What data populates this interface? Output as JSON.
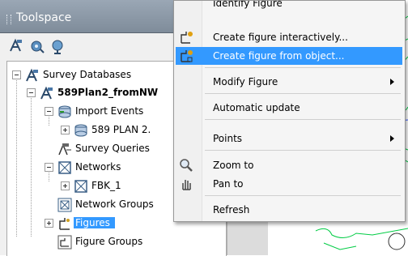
{
  "palette": {
    "title": "Toolspace",
    "toolbar_icons": [
      "survey-toolbar-icon",
      "settings-toolbar-icon",
      "equipment-toolbar-icon"
    ],
    "tree": [
      {
        "label": "Survey Databases",
        "icon": "survey-db-icon",
        "level": 0,
        "expander": "minus"
      },
      {
        "label": "589Plan2_fromNW",
        "icon": "database-icon",
        "level": 1,
        "expander": "minus",
        "bold": true
      },
      {
        "label": "Import Events",
        "icon": "import-events-icon",
        "level": 2,
        "expander": "minus"
      },
      {
        "label": "589 PLAN 2.",
        "icon": "import-event-icon",
        "level": 3,
        "expander": "plus"
      },
      {
        "label": "Survey Queries",
        "icon": "survey-queries-icon",
        "level": 2,
        "expander": null
      },
      {
        "label": "Networks",
        "icon": "networks-icon",
        "level": 2,
        "expander": "minus"
      },
      {
        "label": "FBK_1",
        "icon": "network-icon",
        "level": 3,
        "expander": "plus"
      },
      {
        "label": "Network Groups",
        "icon": "network-groups-icon",
        "level": 2,
        "expander": null
      },
      {
        "label": "Figures",
        "icon": "figures-icon",
        "level": 2,
        "expander": "plus",
        "selected": true
      },
      {
        "label": "Figure Groups",
        "icon": "figure-groups-icon",
        "level": 2,
        "expander": null
      }
    ]
  },
  "context_menu": {
    "items": [
      {
        "label": "Identify Figure",
        "icon": null,
        "highlight": false,
        "submenu": false,
        "partial": true
      },
      {
        "label": "Create figure interactively...",
        "icon": "create-figure-icon",
        "highlight": false,
        "submenu": false
      },
      {
        "label": "Create figure from object...",
        "icon": "create-figure-object-icon",
        "highlight": true,
        "submenu": false
      },
      {
        "label": "Modify Figure",
        "icon": null,
        "highlight": false,
        "submenu": true
      },
      {
        "label": "Automatic update",
        "icon": null,
        "highlight": false,
        "submenu": false
      },
      {
        "label": "Points",
        "icon": null,
        "highlight": false,
        "submenu": true
      },
      {
        "label": "Zoom to",
        "icon": "zoom-icon",
        "highlight": false,
        "submenu": false
      },
      {
        "label": "Pan to",
        "icon": "pan-hand-icon",
        "highlight": false,
        "submenu": false
      },
      {
        "label": "Refresh",
        "icon": null,
        "highlight": false,
        "submenu": false
      }
    ]
  },
  "colors": {
    "selection": "#3399ff",
    "title_bar": "#8c98a6",
    "drawing_lines": "#00cc44"
  }
}
